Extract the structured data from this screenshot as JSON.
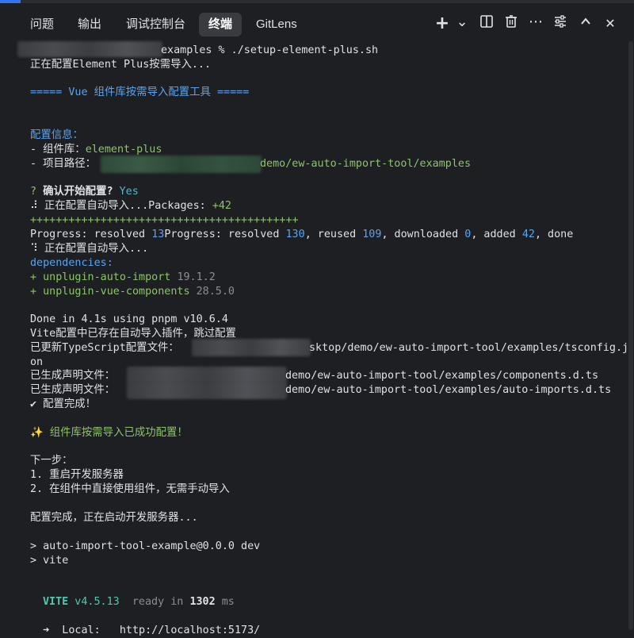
{
  "colors": {
    "background": "#1e1f22",
    "info_blue": "#5aa3f0",
    "value_cyan": "#56b6c2",
    "success_green": "#8bc46a",
    "accent": "#3574f0"
  },
  "tabs": [
    {
      "label": "问题",
      "active": false
    },
    {
      "label": "输出",
      "active": false
    },
    {
      "label": "调试控制台",
      "active": false
    },
    {
      "label": "终端",
      "active": true
    },
    {
      "label": "GitLens",
      "active": false
    }
  ],
  "toolbar_icons": {
    "add": "+",
    "dropdown": "⌄",
    "split": "▯",
    "trash": "🗑",
    "more": "⋯",
    "settings": "☰",
    "maximize": "⌃",
    "close": "✕"
  },
  "terminal": {
    "cmd_suffix": "examples % ./setup-element-plus.sh",
    "configuring": "正在配置Element Plus按需导入...",
    "banner": "===== Vue 组件库按需导入配置工具 =====",
    "info_title": "配置信息：",
    "lib_label": "- 组件库：",
    "lib_value": "element-plus",
    "path_label": "- 项目路径：",
    "path_suffix": "demo/ew-auto-import-tool/examples",
    "confirm_q": "?",
    "confirm_text": "确认开始配置?",
    "confirm_ans": "Yes",
    "auto_import_prefix": "⠼ 正在配置自动导入...Packages: ",
    "auto_import_count": "+42",
    "plus_line": "++++++++++++++++++++++++++++++++++++++++++",
    "progress_a": "Progress: resolved ",
    "progress_b": "13",
    "progress_c": "Progress: resolved ",
    "progress_d": "130",
    "progress_e": ", reused ",
    "progress_f": "109",
    "progress_g": ", downloaded ",
    "progress_h": "0",
    "progress_i": ", added ",
    "progress_j": "42",
    "progress_k": ", done",
    "auto_import2": "⠹ 正在配置自动导入...",
    "deps_title": "dependencies:",
    "dep1_name": "+ unplugin-auto-import ",
    "dep1_ver": "19.1.2",
    "dep2_name": "+ unplugin-vue-components ",
    "dep2_ver": "28.5.0",
    "done": "Done in 4.1s using pnpm v10.6.4",
    "vite_exists": "Vite配置中已存在自动导入插件，跳过配置",
    "updated_label": "已更新TypeScript配置文件：",
    "updated_suffix": "sktop/demo/ew-auto-import-tool/examples/tsconfig.js",
    "updated_wrap": "on",
    "decl1_label": "已生成声明文件：",
    "decl1_suffix": "demo/ew-auto-import-tool/examples/components.d.ts",
    "decl2_label": "已生成声明文件：",
    "decl2_suffix": "demo/ew-auto-import-tool/examples/auto-imports.d.ts",
    "config_done": "✔ 配置完成！",
    "success": "✨ 组件库按需导入已成功配置！",
    "next_title": "下一步：",
    "next1": "1. 重启开发服务器",
    "next2": "2. 在组件中直接使用组件，无需手动导入",
    "starting": "配置完成，正在启动开发服务器...",
    "script_line": "> auto-import-tool-example@0.0.0 dev",
    "vite_line": "> vite",
    "vite_name": "VITE",
    "vite_ver": " v4.5.13",
    "ready_in": "  ready in ",
    "ready_ms": "1302",
    "ms_unit": " ms",
    "local_partial": "  ➜  Local:   http://localhost:5173/"
  }
}
